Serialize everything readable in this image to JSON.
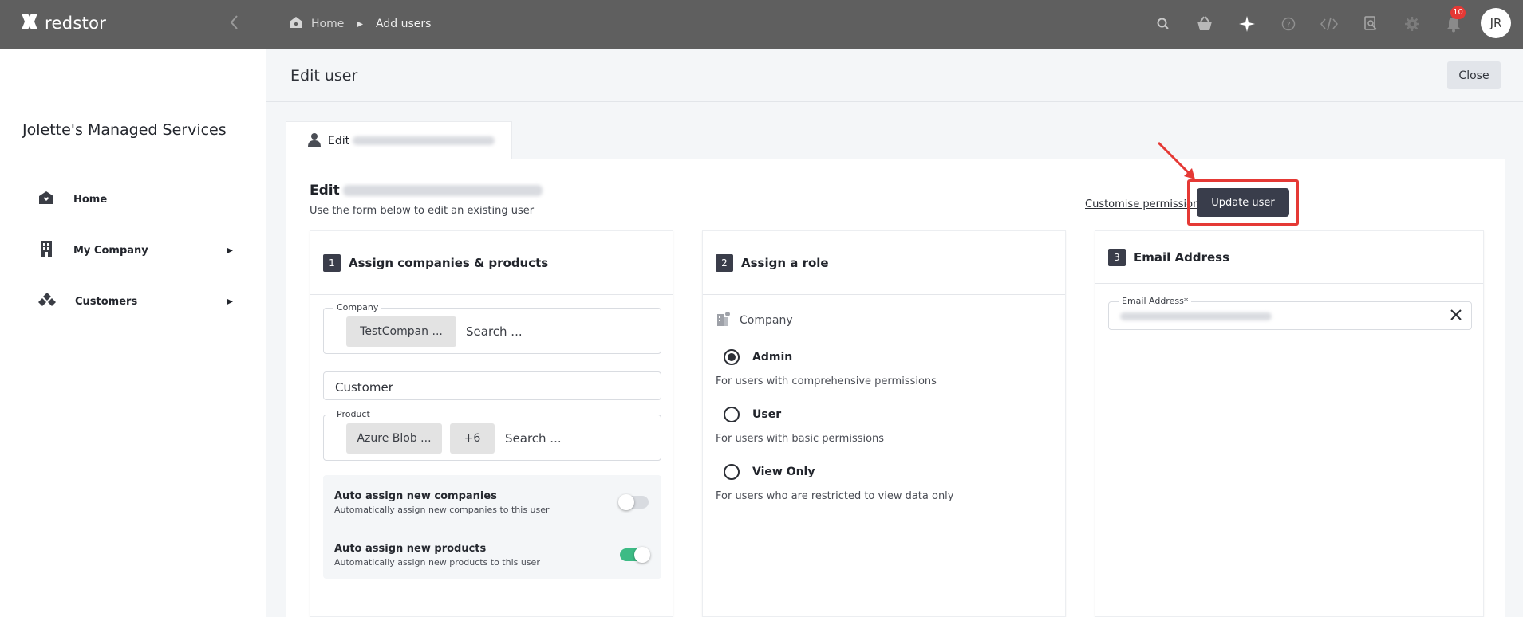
{
  "app": {
    "brand": "redstor"
  },
  "breadcrumb": {
    "home": "Home",
    "current": "Add users"
  },
  "topbar": {
    "icons": [
      "search-icon",
      "basket-icon",
      "sparkle-icon",
      "help-icon",
      "code-icon",
      "search-doc-icon",
      "gear-icon",
      "bell-icon"
    ],
    "notification_count": "10",
    "avatar_initials": "JR"
  },
  "sidebar": {
    "org_name": "Jolette's Managed Services",
    "items": [
      {
        "label": "Home",
        "icon": "home-icon",
        "expandable": false
      },
      {
        "label": "My Company",
        "icon": "building-icon",
        "expandable": true
      },
      {
        "label": "Customers",
        "icon": "customers-icon",
        "expandable": true
      }
    ]
  },
  "page": {
    "title": "Edit user",
    "close_label": "Close"
  },
  "tab": {
    "label": "Edit"
  },
  "form": {
    "heading_prefix": "Edit",
    "subtitle": "Use the form below to edit an existing user",
    "customise_label": "Customise permissions",
    "update_label": "Update user"
  },
  "step1": {
    "number": "1",
    "title": "Assign companies & products",
    "company_label": "Company",
    "company_chip": "TestCompan ...",
    "company_search": "Search ...",
    "customer_value": "Customer",
    "product_label": "Product",
    "product_chip": "Azure Blob ...",
    "product_more": "+6",
    "product_search": "Search ...",
    "auto_companies": {
      "title": "Auto assign new companies",
      "desc": "Automatically assign new companies to this user",
      "enabled": false
    },
    "auto_products": {
      "title": "Auto assign new products",
      "desc": "Automatically assign new products to this user",
      "enabled": true
    }
  },
  "step2": {
    "number": "2",
    "title": "Assign a role",
    "scope": "Company",
    "roles": [
      {
        "label": "Admin",
        "desc": "For users with comprehensive permissions",
        "selected": true
      },
      {
        "label": "User",
        "desc": "For users with basic permissions",
        "selected": false
      },
      {
        "label": "View Only",
        "desc": "For users who are restricted to view data only",
        "selected": false
      }
    ]
  },
  "step3": {
    "number": "3",
    "title": "Email Address",
    "email_label": "Email Address*"
  },
  "colors": {
    "topbar": "#5f5f5f",
    "primary_button": "#393d4b",
    "highlight": "#e53935",
    "toggle_on": "#3dbb85",
    "toggle_off": "#d8dbe0"
  }
}
